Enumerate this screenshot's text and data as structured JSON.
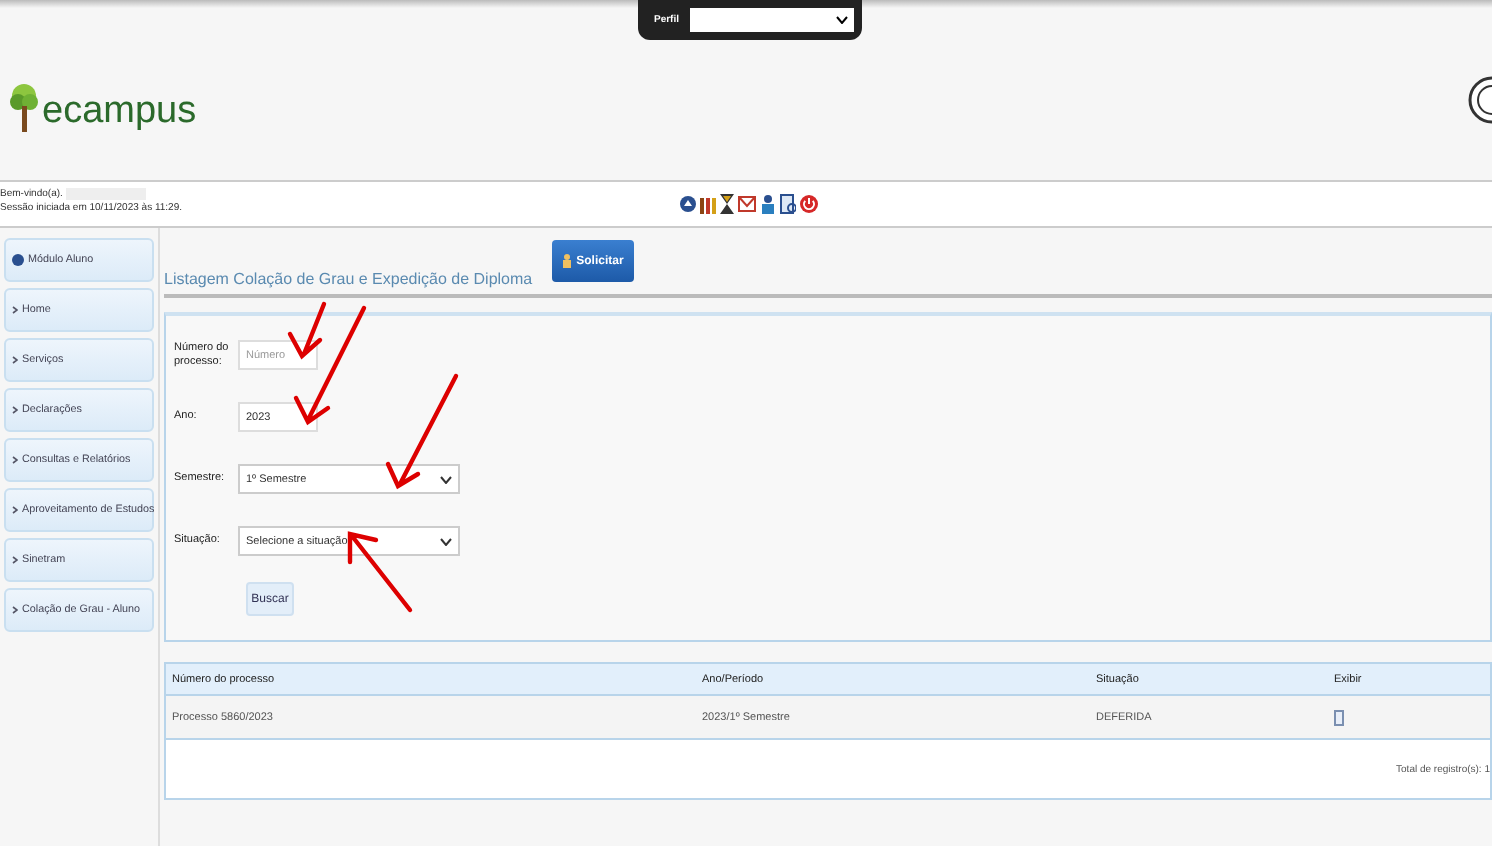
{
  "profile_bar": {
    "label": "Perfil"
  },
  "header": {
    "logo_text": "ecampus"
  },
  "session": {
    "welcome": "Bem-vindo(a).",
    "started": "Sessão iniciada em 10/11/2023 às 11:29."
  },
  "sidebar": {
    "title": "Módulo Aluno",
    "items": [
      {
        "label": "Home"
      },
      {
        "label": "Serviços"
      },
      {
        "label": "Declarações"
      },
      {
        "label": "Consultas e Relatórios"
      },
      {
        "label": "Aproveitamento de Estudos"
      },
      {
        "label": "Sinetram"
      },
      {
        "label": "Colação de Grau - Aluno"
      }
    ]
  },
  "page": {
    "title": "Listagem Colação de Grau e Expedição de Diploma",
    "action_button": "Solicitar"
  },
  "form": {
    "fields": [
      {
        "kind": "text",
        "label": "Número do processo:",
        "placeholder": "Número"
      },
      {
        "kind": "text",
        "label": "Ano:",
        "value": "2023"
      },
      {
        "kind": "select",
        "label": "Semestre:",
        "value": "1º Semestre"
      },
      {
        "kind": "select",
        "label": "Situação:",
        "value": "Selecione a situação"
      }
    ],
    "submit": "Buscar"
  },
  "table": {
    "columns": [
      "Número do processo",
      "Ano/Período",
      "Situação",
      "Exibir"
    ],
    "rows": [
      {
        "process": "Processo 5860/2023",
        "period": "2023/1º Semestre",
        "status": "DEFERIDA"
      }
    ],
    "total": "Total de registro(s): 1"
  }
}
